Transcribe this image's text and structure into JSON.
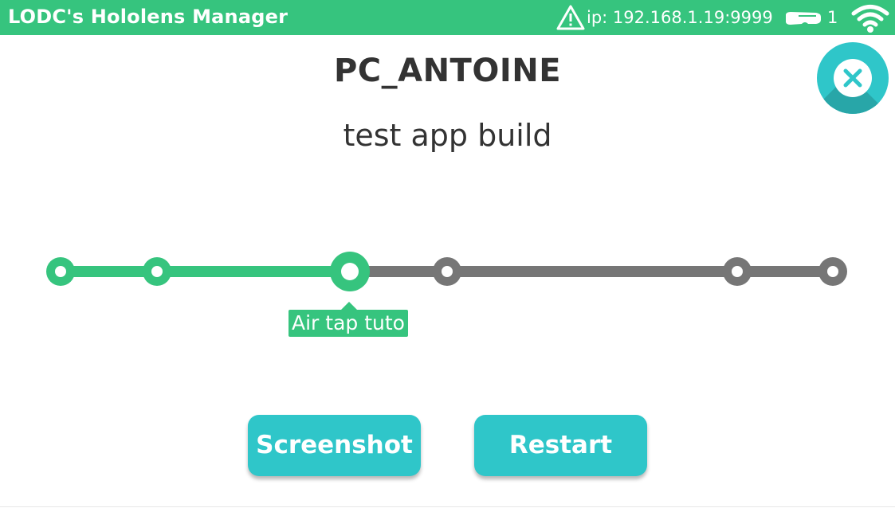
{
  "header": {
    "app_title": "LODC's Hololens Manager",
    "ip_text": "ip: 192.168.1.19:9999",
    "device_count": "1",
    "icons": [
      "warning-icon",
      "hololens-icon",
      "wifi-icon"
    ],
    "background_color": "#36c47e"
  },
  "device": {
    "name": "PC_ANTOINE",
    "build": "test app build"
  },
  "timeline": {
    "step_count": 6,
    "current_step_index": 2,
    "current_step_label": "Air tap tuto",
    "completed_color": "#36c47e",
    "pending_color": "#767676"
  },
  "actions": {
    "screenshot_label": "Screenshot",
    "restart_label": "Restart",
    "color": "#2fc6c9"
  },
  "close_icon": "close-icon"
}
